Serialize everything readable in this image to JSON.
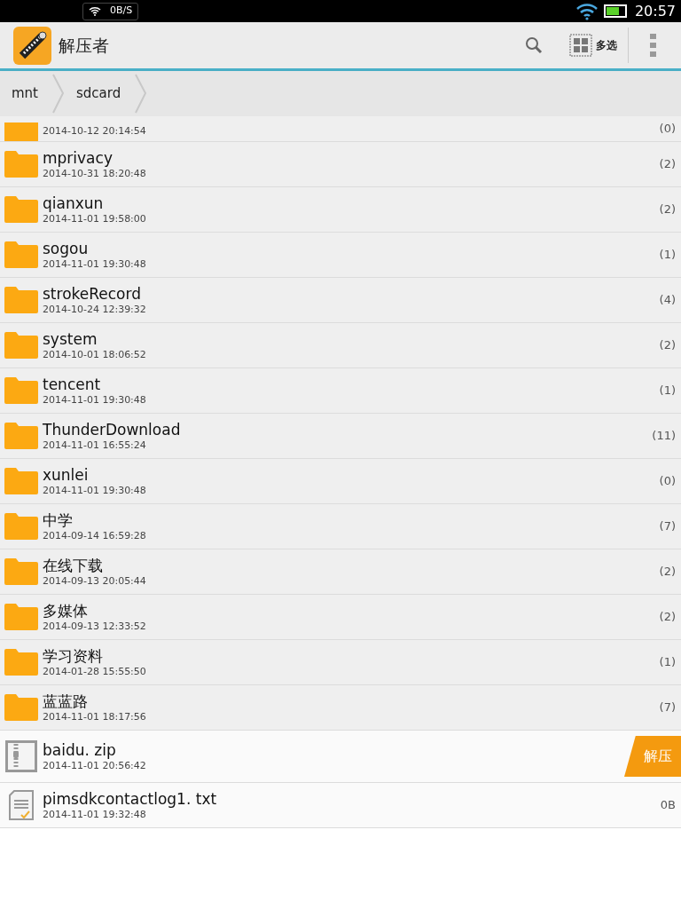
{
  "status_bar": {
    "speed": "0B/S",
    "time": "20:57"
  },
  "app_bar": {
    "title": "解压者",
    "multi_select": "多选"
  },
  "breadcrumbs": [
    "mnt",
    "sdcard"
  ],
  "files": [
    {
      "kind": "folder",
      "date": "2014-10-12  20:14:54",
      "count": "(0)"
    },
    {
      "kind": "folder",
      "name": "mprivacy",
      "date": "2014-10-31  18:20:48",
      "count": "(2)"
    },
    {
      "kind": "folder",
      "name": "qianxun",
      "date": "2014-11-01  19:58:00",
      "count": "(2)"
    },
    {
      "kind": "folder",
      "name": "sogou",
      "date": "2014-11-01  19:30:48",
      "count": "(1)"
    },
    {
      "kind": "folder",
      "name": "strokeRecord",
      "date": "2014-10-24  12:39:32",
      "count": "(4)"
    },
    {
      "kind": "folder",
      "name": "system",
      "date": "2014-10-01  18:06:52",
      "count": "(2)"
    },
    {
      "kind": "folder",
      "name": "tencent",
      "date": "2014-11-01  19:30:48",
      "count": "(1)"
    },
    {
      "kind": "folder",
      "name": "ThunderDownload",
      "date": "2014-11-01  16:55:24",
      "count": "(11)"
    },
    {
      "kind": "folder",
      "name": "xunlei",
      "date": "2014-11-01  19:30:48",
      "count": "(0)"
    },
    {
      "kind": "folder",
      "name": "中学",
      "date": "2014-09-14  16:59:28",
      "count": "(7)"
    },
    {
      "kind": "folder",
      "name": "在线下载",
      "date": "2014-09-13  20:05:44",
      "count": "(2)"
    },
    {
      "kind": "folder",
      "name": "多媒体",
      "date": "2014-09-13  12:33:52",
      "count": "(2)"
    },
    {
      "kind": "folder",
      "name": "学习资料",
      "date": "2014-01-28  15:55:50",
      "count": "(1)"
    },
    {
      "kind": "folder",
      "name": "蓝蓝路",
      "date": "2014-11-01  18:17:56",
      "count": "(7)"
    },
    {
      "kind": "zip",
      "name": "baidu. zip",
      "date": "2014-11-01  20:56:42",
      "action": "解压"
    },
    {
      "kind": "text",
      "name": "pimsdkcontactlog1. txt",
      "date": "2014-11-01  19:32:48",
      "count": "0B"
    }
  ]
}
